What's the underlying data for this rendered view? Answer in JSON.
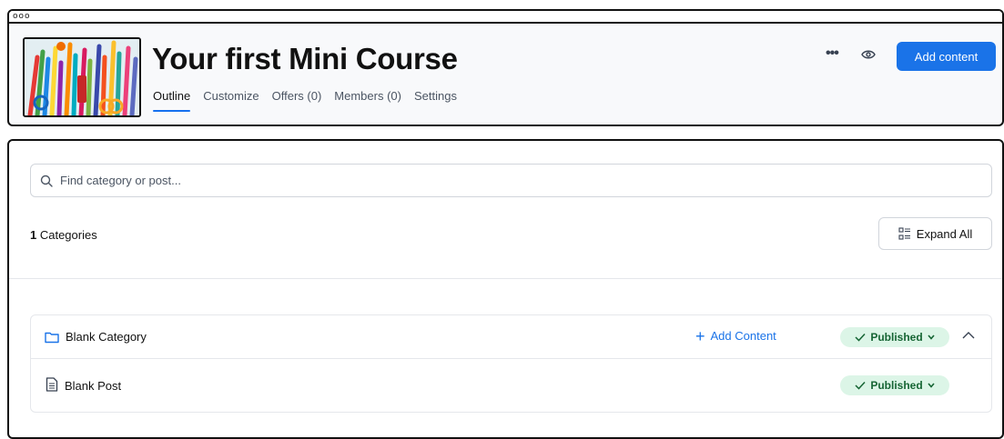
{
  "window": {
    "dots": "ooo"
  },
  "header": {
    "title": "Your first Mini Course",
    "tabs": [
      {
        "label": "Outline",
        "active": true
      },
      {
        "label": "Customize"
      },
      {
        "label": "Offers (0)"
      },
      {
        "label": "Members (0)"
      },
      {
        "label": "Settings"
      }
    ],
    "more_icon": "more-icon",
    "more_label": "•••",
    "preview_icon": "eye-icon",
    "add_content_label": "Add content",
    "accent": "#1a73e8"
  },
  "search": {
    "placeholder": "Find category or post..."
  },
  "summary": {
    "count": "1",
    "count_label": " Categories"
  },
  "expand": {
    "label": "Expand All",
    "icon": "expand-list-icon"
  },
  "categories": [
    {
      "name": "Blank Category",
      "icon": "folder-icon",
      "add_label": "Add Content",
      "status": "Published",
      "posts": [
        {
          "name": "Blank Post",
          "icon": "document-icon",
          "status": "Published"
        }
      ]
    }
  ],
  "colors": {
    "published_bg": "#dcf5e7",
    "published_text": "#166534"
  }
}
